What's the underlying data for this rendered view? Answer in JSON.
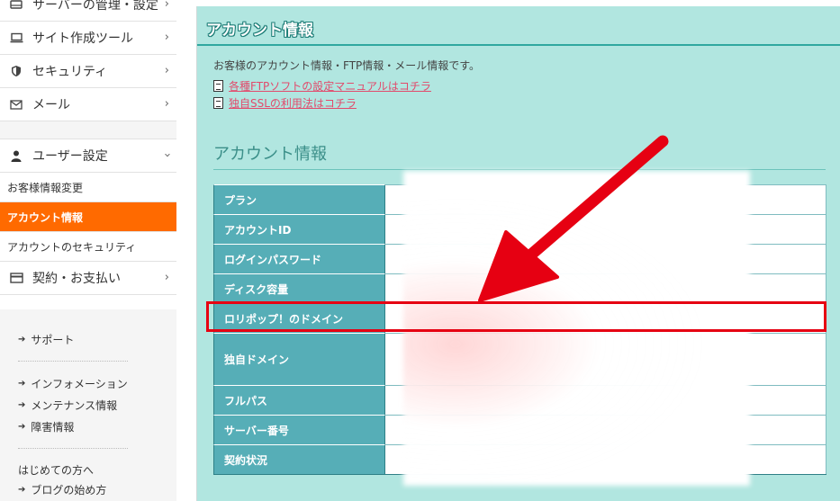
{
  "sidebar": {
    "nav": [
      {
        "label": "サーバーの管理・設定",
        "icon": "server-icon"
      },
      {
        "label": "サイト作成ツール",
        "icon": "laptop-icon"
      },
      {
        "label": "セキュリティ",
        "icon": "shield-icon"
      },
      {
        "label": "メール",
        "icon": "mail-icon"
      }
    ],
    "user_settings": {
      "label": "ユーザー設定",
      "icon": "user-icon"
    },
    "sub_items": [
      "お客様情報変更",
      "アカウント情報",
      "アカウントのセキュリティ"
    ],
    "billing": {
      "label": "契約・お支払い",
      "icon": "card-icon"
    },
    "support_links": [
      {
        "label": "サポート"
      },
      {
        "label": "インフォメーション"
      },
      {
        "label": "メンテナンス情報"
      },
      {
        "label": "障害情報"
      }
    ],
    "beginner": {
      "label": "はじめての方へ"
    },
    "blog_link": {
      "label": "ブログの始め方"
    }
  },
  "main": {
    "title": "アカウント情報",
    "description": "お客様のアカウント情報・FTP情報・メール情報です。",
    "links": [
      "各種FTPソフトの設定マニュアルはコチラ",
      "独自SSLの利用法はコチラ"
    ],
    "section_heading": "アカウント情報",
    "table_rows": [
      "プラン",
      "アカウントID",
      "ログインパスワード",
      "ディスク容量",
      "ロリポップ！のドメイン",
      "独自ドメイン",
      "フルパス",
      "サーバー番号",
      "契約状況"
    ]
  },
  "colors": {
    "accent_orange": "#ff6a00",
    "panel_teal": "#b1e6e0",
    "label_teal": "#56aeb7",
    "highlight_red": "#e60012",
    "link_pink": "#e24a6b"
  }
}
